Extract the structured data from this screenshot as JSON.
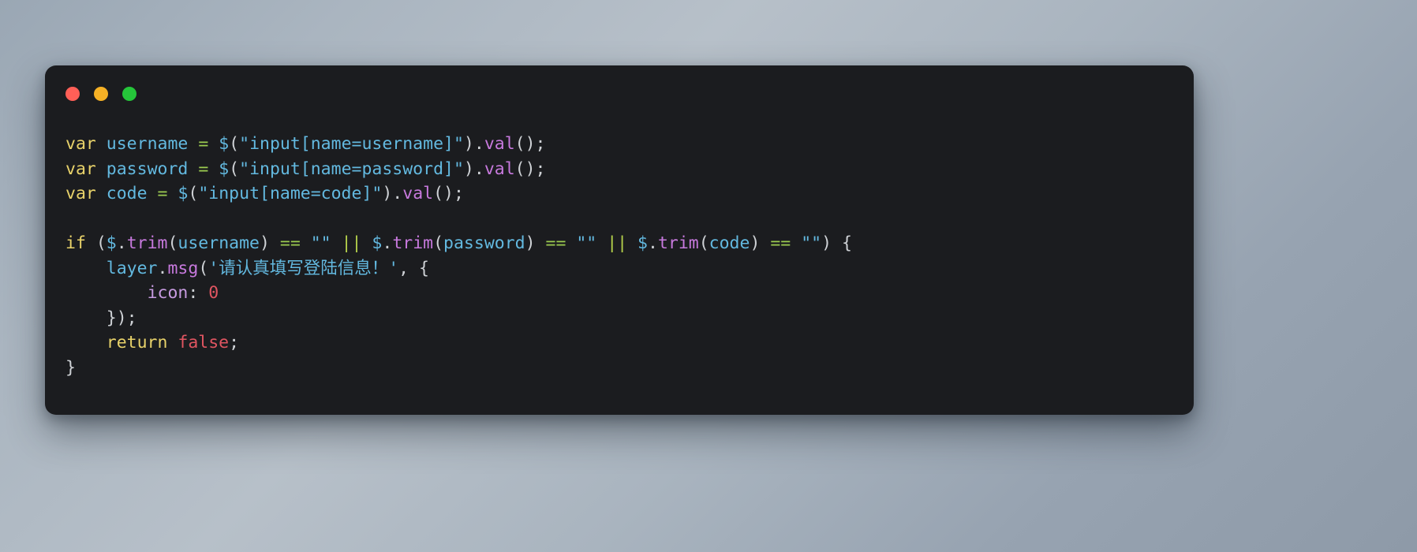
{
  "window": {
    "name": "code-snippet-window",
    "theme_background": "#1b1c1f",
    "page_background_start": "#9aa7b4",
    "page_background_end": "#8e9aa8",
    "traffic_lights": [
      {
        "name": "close",
        "color": "#ff5f57"
      },
      {
        "name": "minimize",
        "color": "#f6b125"
      },
      {
        "name": "maximize",
        "color": "#25c63a"
      }
    ]
  },
  "code": {
    "language": "javascript",
    "lines": [
      {
        "n": 1,
        "text": "var username = $(\"input[name=username]\").val();",
        "tokens": [
          {
            "t": "var",
            "c": "kw"
          },
          {
            "t": " ",
            "c": "pun"
          },
          {
            "t": "username",
            "c": "var"
          },
          {
            "t": " ",
            "c": "pun"
          },
          {
            "t": "=",
            "c": "op"
          },
          {
            "t": " ",
            "c": "pun"
          },
          {
            "t": "$",
            "c": "dol"
          },
          {
            "t": "(",
            "c": "pun"
          },
          {
            "t": "\"input[name=username]\"",
            "c": "str"
          },
          {
            "t": ")",
            "c": "pun"
          },
          {
            "t": ".",
            "c": "pun"
          },
          {
            "t": "val",
            "c": "fn"
          },
          {
            "t": "();",
            "c": "pun"
          }
        ]
      },
      {
        "n": 2,
        "text": "var password = $(\"input[name=password]\").val();",
        "tokens": [
          {
            "t": "var",
            "c": "kw"
          },
          {
            "t": " ",
            "c": "pun"
          },
          {
            "t": "password",
            "c": "var"
          },
          {
            "t": " ",
            "c": "pun"
          },
          {
            "t": "=",
            "c": "op"
          },
          {
            "t": " ",
            "c": "pun"
          },
          {
            "t": "$",
            "c": "dol"
          },
          {
            "t": "(",
            "c": "pun"
          },
          {
            "t": "\"input[name=password]\"",
            "c": "str"
          },
          {
            "t": ")",
            "c": "pun"
          },
          {
            "t": ".",
            "c": "pun"
          },
          {
            "t": "val",
            "c": "fn"
          },
          {
            "t": "();",
            "c": "pun"
          }
        ]
      },
      {
        "n": 3,
        "text": "var code = $(\"input[name=code]\").val();",
        "tokens": [
          {
            "t": "var",
            "c": "kw"
          },
          {
            "t": " ",
            "c": "pun"
          },
          {
            "t": "code",
            "c": "var"
          },
          {
            "t": " ",
            "c": "pun"
          },
          {
            "t": "=",
            "c": "op"
          },
          {
            "t": " ",
            "c": "pun"
          },
          {
            "t": "$",
            "c": "dol"
          },
          {
            "t": "(",
            "c": "pun"
          },
          {
            "t": "\"input[name=code]\"",
            "c": "str"
          },
          {
            "t": ")",
            "c": "pun"
          },
          {
            "t": ".",
            "c": "pun"
          },
          {
            "t": "val",
            "c": "fn"
          },
          {
            "t": "();",
            "c": "pun"
          }
        ]
      },
      {
        "n": 4,
        "text": "",
        "tokens": []
      },
      {
        "n": 5,
        "text": "if ($.trim(username) == \"\" || $.trim(password) == \"\" || $.trim(code) == \"\") {",
        "tokens": [
          {
            "t": "if",
            "c": "kw"
          },
          {
            "t": " (",
            "c": "pun"
          },
          {
            "t": "$",
            "c": "dol"
          },
          {
            "t": ".",
            "c": "pun"
          },
          {
            "t": "trim",
            "c": "fn"
          },
          {
            "t": "(",
            "c": "pun"
          },
          {
            "t": "username",
            "c": "var"
          },
          {
            "t": ") ",
            "c": "pun"
          },
          {
            "t": "==",
            "c": "op"
          },
          {
            "t": " ",
            "c": "pun"
          },
          {
            "t": "\"\"",
            "c": "str"
          },
          {
            "t": " ",
            "c": "pun"
          },
          {
            "t": "||",
            "c": "or"
          },
          {
            "t": " ",
            "c": "pun"
          },
          {
            "t": "$",
            "c": "dol"
          },
          {
            "t": ".",
            "c": "pun"
          },
          {
            "t": "trim",
            "c": "fn"
          },
          {
            "t": "(",
            "c": "pun"
          },
          {
            "t": "password",
            "c": "var"
          },
          {
            "t": ") ",
            "c": "pun"
          },
          {
            "t": "==",
            "c": "op"
          },
          {
            "t": " ",
            "c": "pun"
          },
          {
            "t": "\"\"",
            "c": "str"
          },
          {
            "t": " ",
            "c": "pun"
          },
          {
            "t": "||",
            "c": "or"
          },
          {
            "t": " ",
            "c": "pun"
          },
          {
            "t": "$",
            "c": "dol"
          },
          {
            "t": ".",
            "c": "pun"
          },
          {
            "t": "trim",
            "c": "fn"
          },
          {
            "t": "(",
            "c": "pun"
          },
          {
            "t": "code",
            "c": "var"
          },
          {
            "t": ") ",
            "c": "pun"
          },
          {
            "t": "==",
            "c": "op"
          },
          {
            "t": " ",
            "c": "pun"
          },
          {
            "t": "\"\"",
            "c": "str"
          },
          {
            "t": ") {",
            "c": "pun"
          }
        ]
      },
      {
        "n": 6,
        "text": "    layer.msg('请认真填写登陆信息！', {",
        "tokens": [
          {
            "t": "    ",
            "c": "pun"
          },
          {
            "t": "layer",
            "c": "var"
          },
          {
            "t": ".",
            "c": "pun"
          },
          {
            "t": "msg",
            "c": "fn"
          },
          {
            "t": "(",
            "c": "pun"
          },
          {
            "t": "'请认真填写登陆信息！'",
            "c": "str"
          },
          {
            "t": ", {",
            "c": "pun"
          }
        ]
      },
      {
        "n": 7,
        "text": "        icon: 0",
        "tokens": [
          {
            "t": "        ",
            "c": "pun"
          },
          {
            "t": "icon",
            "c": "prop"
          },
          {
            "t": ": ",
            "c": "pun"
          },
          {
            "t": "0",
            "c": "num"
          }
        ]
      },
      {
        "n": 8,
        "text": "    });",
        "tokens": [
          {
            "t": "    });",
            "c": "pun"
          }
        ]
      },
      {
        "n": 9,
        "text": "    return false;",
        "tokens": [
          {
            "t": "    ",
            "c": "pun"
          },
          {
            "t": "return",
            "c": "kw"
          },
          {
            "t": " ",
            "c": "pun"
          },
          {
            "t": "false",
            "c": "bool"
          },
          {
            "t": ";",
            "c": "pun"
          }
        ]
      },
      {
        "n": 10,
        "text": "}",
        "tokens": [
          {
            "t": "}",
            "c": "pun"
          }
        ]
      }
    ]
  }
}
